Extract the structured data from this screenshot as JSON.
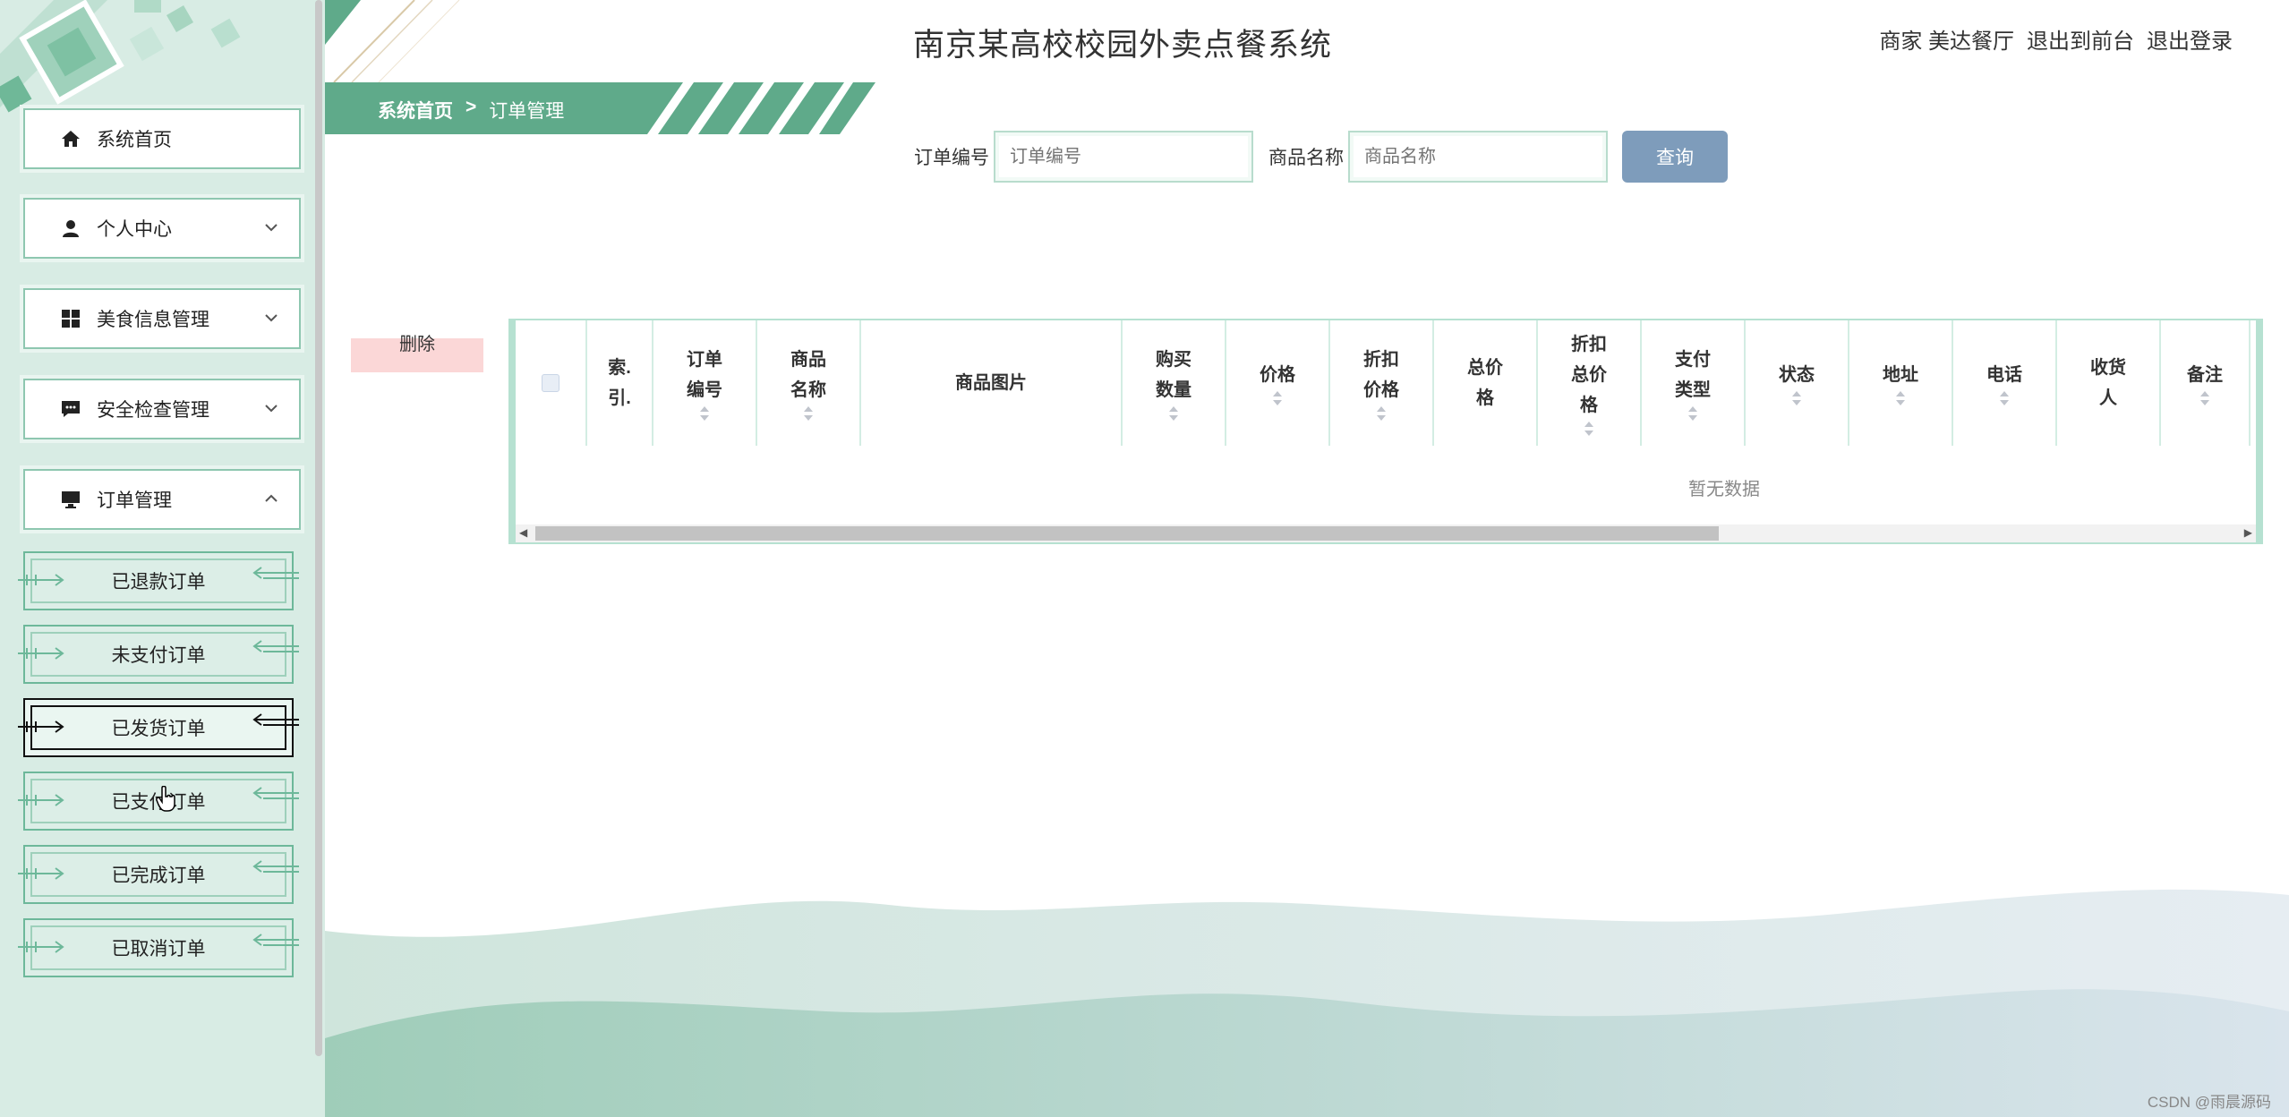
{
  "header": {
    "app_title": "南京某高校校园外卖点餐系统",
    "user_role": "商家",
    "user_name": "美达餐厅",
    "link_front": "退出到前台",
    "link_logout": "退出登录"
  },
  "breadcrumb": {
    "home": "系统首页",
    "separator": ">",
    "current": "订单管理"
  },
  "sidebar": {
    "items": [
      {
        "label": "系统首页",
        "icon": "home-icon",
        "expandable": false
      },
      {
        "label": "个人中心",
        "icon": "user-icon",
        "expandable": true,
        "expanded": false
      },
      {
        "label": "美食信息管理",
        "icon": "grid-icon",
        "expandable": true,
        "expanded": false
      },
      {
        "label": "安全检查管理",
        "icon": "chat-icon",
        "expandable": true,
        "expanded": false
      },
      {
        "label": "订单管理",
        "icon": "monitor-icon",
        "expandable": true,
        "expanded": true
      }
    ],
    "sub_items": [
      {
        "label": "已退款订单",
        "active": false
      },
      {
        "label": "未支付订单",
        "active": false
      },
      {
        "label": "已发货订单",
        "active": true
      },
      {
        "label": "已支付订单",
        "active": false
      },
      {
        "label": "已完成订单",
        "active": false
      },
      {
        "label": "已取消订单",
        "active": false
      }
    ]
  },
  "search": {
    "order_no_label": "订单编号",
    "order_no_placeholder": "订单编号",
    "order_no_value": "",
    "product_name_label": "商品名称",
    "product_name_placeholder": "商品名称",
    "product_name_value": "",
    "query_button": "查询"
  },
  "actions": {
    "delete_button": "删除"
  },
  "table": {
    "columns": [
      {
        "key": "checkbox",
        "lines": [
          ""
        ],
        "sortable": false
      },
      {
        "key": "index",
        "lines": [
          "索.",
          "引."
        ],
        "sortable": false
      },
      {
        "key": "order_no",
        "lines": [
          "订单",
          "编号"
        ],
        "sortable": true
      },
      {
        "key": "product_name",
        "lines": [
          "商品",
          "名称"
        ],
        "sortable": true
      },
      {
        "key": "product_image",
        "lines": [
          "商品图片"
        ],
        "sortable": true
      },
      {
        "key": "quantity",
        "lines": [
          "购买",
          "数量"
        ],
        "sortable": true
      },
      {
        "key": "price",
        "lines": [
          "价格"
        ],
        "sortable": true
      },
      {
        "key": "discount_price",
        "lines": [
          "折扣",
          "价格"
        ],
        "sortable": true
      },
      {
        "key": "total_price",
        "lines": [
          "总价",
          "格"
        ],
        "sortable": true
      },
      {
        "key": "discount_total",
        "lines": [
          "折扣",
          "总价",
          "格"
        ],
        "sortable": true
      },
      {
        "key": "payment_type",
        "lines": [
          "支付",
          "类型"
        ],
        "sortable": true
      },
      {
        "key": "status",
        "lines": [
          "状态"
        ],
        "sortable": true
      },
      {
        "key": "address",
        "lines": [
          "地址"
        ],
        "sortable": true
      },
      {
        "key": "phone",
        "lines": [
          "电话"
        ],
        "sortable": true
      },
      {
        "key": "receiver",
        "lines": [
          "收货",
          "人"
        ],
        "sortable": true
      },
      {
        "key": "remark",
        "lines": [
          "备注"
        ],
        "sortable": true
      }
    ],
    "rows": [],
    "empty_text": "暂无数据"
  },
  "watermark": "CSDN @雨晨源码",
  "colors": {
    "sidebar_bg": "#d8ece4",
    "accent_green": "#5faa8a",
    "query_button": "#7e9cbb",
    "delete_button": "#fbd7d7",
    "table_border": "#b6e1d1"
  }
}
